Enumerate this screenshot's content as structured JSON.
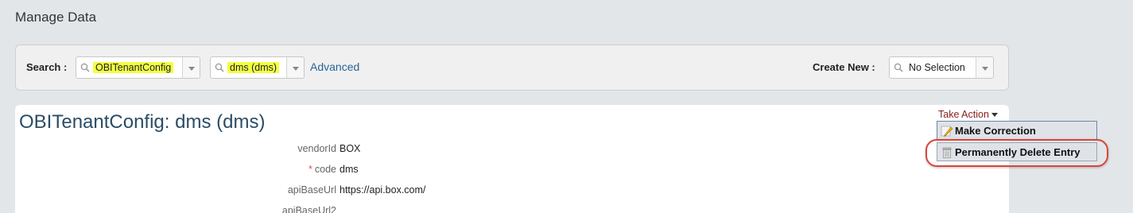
{
  "page": {
    "title": "Manage Data"
  },
  "search": {
    "label": "Search :",
    "object_value": "OBITenantConfig",
    "record_value": "dms (dms)",
    "advanced_link": "Advanced"
  },
  "create_new": {
    "label": "Create New :",
    "value": "No Selection"
  },
  "record": {
    "title": "OBITenantConfig: dms (dms)",
    "take_action": "Take Action",
    "fields": [
      {
        "label": "vendorId",
        "value": "BOX",
        "required": false
      },
      {
        "label": "code",
        "value": "dms",
        "required": true,
        "required_mark": "*"
      },
      {
        "label": "apiBaseUrl",
        "value": "https://api.box.com/",
        "required": false
      },
      {
        "label": "apiBaseUrl2",
        "value": "",
        "required": false
      }
    ]
  },
  "action_menu": {
    "items": [
      {
        "label": "Make Correction",
        "icon": "pencil-icon"
      },
      {
        "label": "Permanently Delete Entry",
        "icon": "trash-icon"
      }
    ]
  },
  "colors": {
    "highlight": "#f2ff44",
    "link": "#2a6496",
    "take_action": "#8a1c1c",
    "annotation_ring": "#d9443b"
  }
}
